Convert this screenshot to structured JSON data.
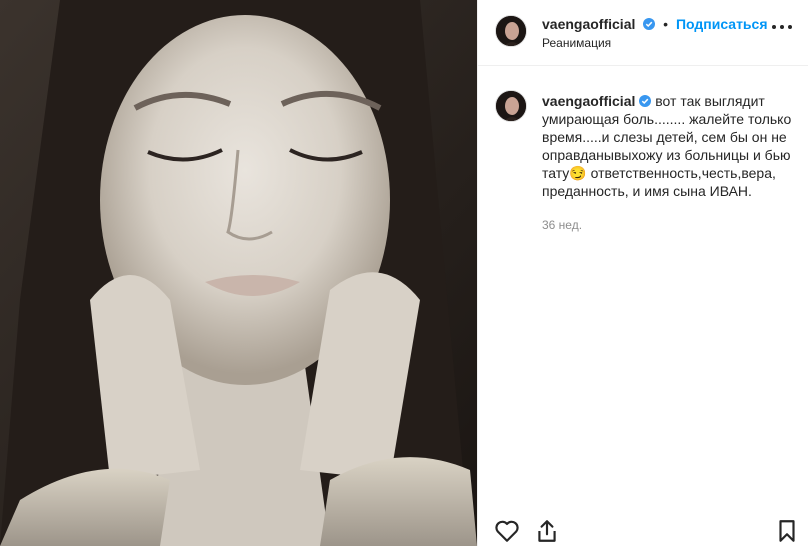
{
  "post": {
    "username": "vaengaofficial",
    "separator": "•",
    "follow_label": "Подписаться",
    "location": "Реанимация"
  },
  "caption": {
    "username": "vaengaofficial",
    "text": "вот так выглядит умирающая боль........ жалейте только время.....и слезы детей, сем бы он не оправданывыхожу из больницы и бью тату😏 ответственность,честь,вера, преданность, и имя сына ИВАН.",
    "time": "36 нед."
  },
  "icons": {
    "verified": "verified-badge-icon",
    "more": "more-options-icon",
    "like": "heart-icon",
    "share": "share-icon",
    "save": "bookmark-icon"
  },
  "colors": {
    "accent": "#0095f6",
    "muted": "#8e8e8e",
    "text": "#262626"
  }
}
